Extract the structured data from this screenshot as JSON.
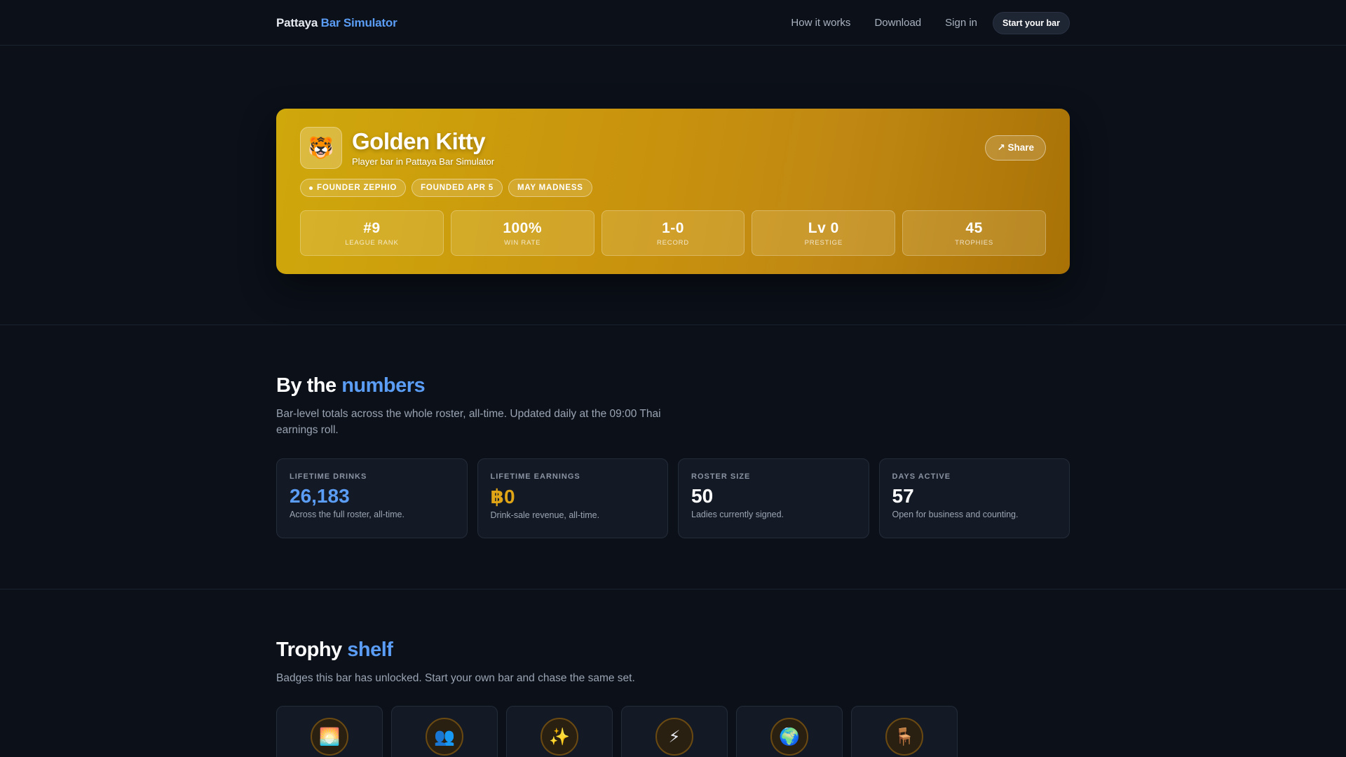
{
  "nav": {
    "brand_main": "Pattaya",
    "brand_accent": "Bar Simulator",
    "links": [
      "How it works",
      "Download",
      "Sign in"
    ],
    "cta": "Start your bar"
  },
  "hero": {
    "avatar_emoji": "🐯",
    "name": "Golden Kitty",
    "subtitle": "Player bar in Pattaya Bar Simulator",
    "share": "↗ Share",
    "chips": [
      "FOUNDER ZEPHIO",
      "FOUNDED APR 5",
      "MAY MADNESS"
    ],
    "stats": [
      {
        "value": "#9",
        "label": "LEAGUE RANK"
      },
      {
        "value": "100%",
        "label": "WIN RATE"
      },
      {
        "value": "1-0",
        "label": "RECORD"
      },
      {
        "value": "Lv 0",
        "label": "PRESTIGE"
      },
      {
        "value": "45",
        "label": "TROPHIES"
      }
    ]
  },
  "numbers": {
    "title_main": "By the",
    "title_accent": "numbers",
    "description": "Bar-level totals across the whole roster, all-time. Updated daily at the 09:00 Thai earnings roll.",
    "metrics": [
      {
        "label": "LIFETIME DRINKS",
        "value": "26,183",
        "sub": "Across the full roster, all-time.",
        "color": "#5b9df5"
      },
      {
        "label": "LIFETIME EARNINGS",
        "value": "฿0",
        "sub": "Drink-sale revenue, all-time.",
        "color": "#e0a516"
      },
      {
        "label": "ROSTER SIZE",
        "value": "50",
        "sub": "Ladies currently signed.",
        "color": "#ffffff"
      },
      {
        "label": "DAYS ACTIVE",
        "value": "57",
        "sub": "Open for business and counting.",
        "color": "#ffffff"
      }
    ]
  },
  "trophies": {
    "title_main": "Trophy",
    "title_accent": "shelf",
    "description": "Badges this bar has unlocked. Start your own bar and chase the same set.",
    "badges": [
      {
        "icon": "🌅"
      },
      {
        "icon": "👥"
      },
      {
        "icon": "✨"
      },
      {
        "icon": "⚡"
      },
      {
        "icon": "🌍"
      },
      {
        "icon": "🪑"
      }
    ]
  }
}
